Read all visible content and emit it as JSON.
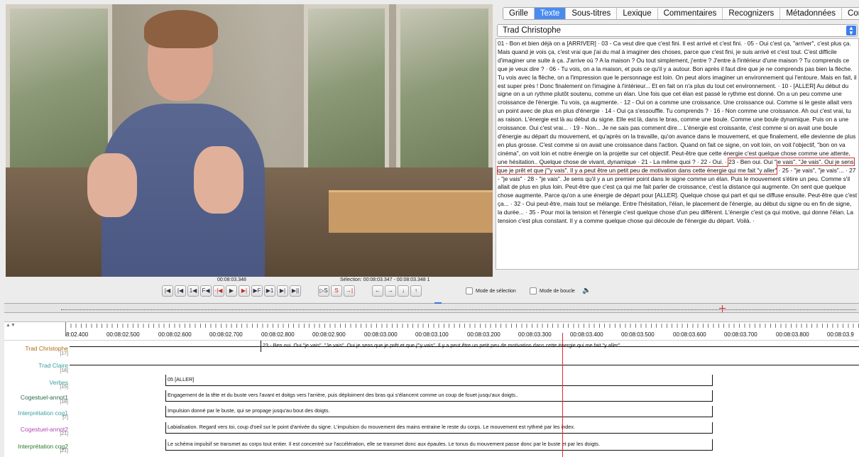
{
  "tabs": [
    "Grille",
    "Texte",
    "Sous-titres",
    "Lexique",
    "Commentaires",
    "Recognizers",
    "Métadonnées",
    "Contrôles"
  ],
  "active_tab": "Texte",
  "tier_select": "Trad Christophe",
  "transcript_before": "01 - Bon et bien déjà on a [ARRIVER]  ·  03 - Ca veut dire que c'est fini. Il est arrivé et c'est fini.  ·  05 - Oui c'est ça, \"arriver\", c'est plus ça. Mais quand je vois ça, c'est vrai que j'ai du mal à imaginer des choses, parce que c'est fini, je suis arrivé et c'est tout. C'est difficile d'imaginer une suite à ça. J'arrive où ? A la maison ? Ou tout simplement, j'entre ? J'entre à l'intérieur d'une maison ? Tu comprends ce que je veux dire ?  ·  06 - Tu vois, on a la maison, et puis ce qu'il y a autour. Bon après il faut dire que je ne comprends pas bien la flèche. Tu vois avec la flèche, on a l'impression que le personnage est loin. On peut alors imaginer un environnement qui l'entoure. Mais en fait, il est super près ! Donc finalement on l'imagine à l'intérieur... Et en fait on n'a plus du tout cet environnement.  ·  10 - [ALLER] Au début du signe on a un rythme plutôt soutenu, comme un élan. Une fois que cet élan est passé le rythme est donné. On a un peu comme une croissance de l'énergie. Tu vois, ça augmente.  ·  12 - Oui on a comme une croissance. Une croissance oui. Comme si le geste allait vers un point avec de plus en plus d'énergie  ·  14 - Oui ça s'essouffle. Tu comprends ?  ·  16 - Non comme une croissance. Ah oui c'est vrai, tu as raison. L'énergie est là au début du signe. Elle est là, dans le bras, comme une boule. Comme une boule dynamique. Puis on a une croissance. Oui c'est vrai...  ·  19 - Non... Je ne sais pas comment dire... L'énergie est croissante, c'est comme si on avait une boule d'énergie au départ du mouvement, et qu'après on la travaille, qu'on avance dans le mouvement, et que finalement, elle devienne de plus en plus grosse. C'est comme si on avait une croissance dans l'action. Quand on fait ce signe, on voit loin, on voit l'objectif, \"bon on va cinéma\", on voit loin et notre énergie on la projette sur cet objectif. Peut-être que cette énergie c'est quelque chose comme une attente, une hésitation.. Quelque chose de vivant, dynamique  ·  21 - La même quoi ?  ·  22 - Oui.  ·  ",
  "transcript_selected": "23 - Ben oui. Oui \"je vais\". \"Je vais\". Oui je sens que je prêt et que j'\"y vais\". Il y a peut être un petit peu de motivation dans cette énergie qui me fait \"y aller\"",
  "transcript_after": "  ·  25 - \"je vais\", \"je vais\"...  ·  27 - \"je vais\"  ·  28 - \"je vais\". Je sens qu'il y a un premier point dans le signe comme un élan. Puis le mouvement s'étire un peu. Comme s'il allait de plus en plus loin. Peut-être que c'est ça qui me fait parler de croissance, c'est la distance qui augmente. On sent que quelque chose augmente. Parce qu'on a une énergie de départ pour [ALLER]. Quelque chose qui part et qui se diffuse ensuite. Peut-être que c'est ça...  ·  32 - Oui peut-être, mais tout se mélange. Entre l'hésitation, l'élan, le placement de l'énergie, au début du signe ou en fin de signe, la durée...  ·  35 - Pour moi la tension et l'énergie c'est quelque chose d'un peu différent. L'énergie c'est ça qui motive, qui donne l'élan. La tension c'est plus constant. Il y a comme quelque chose qui découle de l'énergie du départ. Voilà.  ·",
  "timecode": "00:08:03.348",
  "selection": "Sélection: 00:08:03.347 - 00:08:03.348  1",
  "transport_buttons": [
    "|◀",
    "|◀",
    "1◀",
    "F◀",
    "-|◀",
    "▶",
    "▶|",
    "▶F",
    "▶1",
    "▶|",
    "▶||",
    "▷S",
    "S",
    "→|",
    "←",
    "→",
    "↓",
    "↑"
  ],
  "mode_selection": "Mode de sélection",
  "mode_boucle": "Mode de boucle",
  "ruler_labels": [
    "8:02.400",
    "00:08:02.500",
    "00:08:02.600",
    "00:08:02.700",
    "00:08:02.800",
    "00:08:02.900",
    "00:08:03.000",
    "00:08:03.100",
    "00:08:03.200",
    "00:08:03.300",
    "00:08:03.400",
    "00:08:03.500",
    "00:08:03.600",
    "00:08:03.700",
    "00:08:03.800",
    "00:08:03.9"
  ],
  "tiers": [
    {
      "name": "Trad Christophe",
      "num": "[17]",
      "color": "#b06a10",
      "ann": "23 - Ben oui. Oui \"je vais\". \"Je vais\". Oui je sens que je prêt et que j'\"y vais\". Il y a peut être un petit peu de motivation dans cette énergie qui me fait \"y aller\""
    },
    {
      "name": "Trad Claire",
      "num": "[18]",
      "color": "#3aa0a0",
      "ann": ""
    },
    {
      "name": "Verbes",
      "num": "[15]",
      "color": "#3aa0a0",
      "ann": "05 [ALLER]"
    },
    {
      "name": "Cogestuel-annot1",
      "num": "[18]",
      "color": "#2a6a4a",
      "ann": "Engagement de la tête et du buste vers l'avant et doitgs vers l'arrière, puis déploiment des bras qui s'élancent comme un coup de fouet jusqu'aux doigts.."
    },
    {
      "name": "Interprétation cog1",
      "num": "[7]",
      "color": "#3aa0a0",
      "ann": "Impulsion donné par le buste, qui se propage jusqu'au bout des doigts."
    },
    {
      "name": "Cogestuel-annot2",
      "num": "[21]",
      "color": "#b04ab0",
      "ann": "Labialisation. Regard vers toi, coup d'oeil sur le point d'arrivée du signe. L'impulsion du mouvement des mains entraine le reste du corps.  Le mouvement est rythmé par les index."
    },
    {
      "name": "Interprétation cog2",
      "num": "[21]",
      "color": "#2a7a2a",
      "ann": "Le schéma impulsif se transmet au corps tout entier. Il est concentré sur l'accélération, elle se transmet donc aux épaules. Le tonus du mouvement passe donc par le buste et par les doigts."
    }
  ]
}
